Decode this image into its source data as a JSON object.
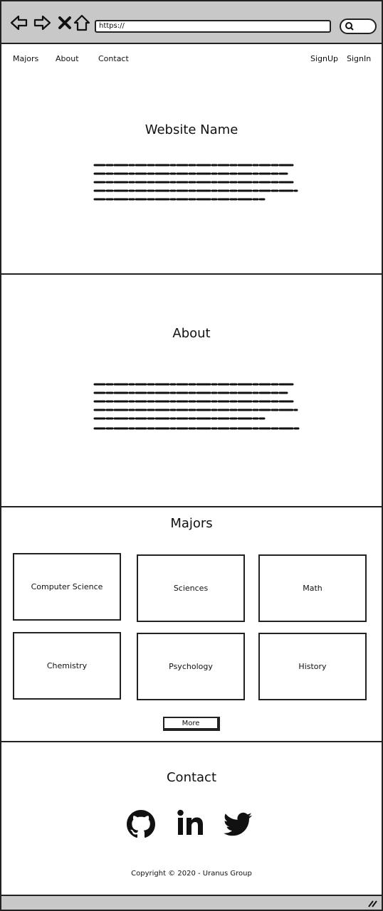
{
  "browser": {
    "url": "https://"
  },
  "nav": {
    "majors": "Majors",
    "about": "About",
    "contact": "Contact",
    "signup": "SignUp",
    "signin": "SignIn"
  },
  "hero": {
    "title": "Website Name"
  },
  "about": {
    "title": "About"
  },
  "majors": {
    "title": "Majors",
    "items": [
      {
        "label": "Computer Science"
      },
      {
        "label": "Sciences"
      },
      {
        "label": "Math"
      },
      {
        "label": "Chemistry"
      },
      {
        "label": "Psychology"
      },
      {
        "label": "History"
      }
    ],
    "more_label": "More"
  },
  "contact": {
    "title": "Contact",
    "social_icons": [
      "github-icon",
      "linkedin-icon",
      "twitter-icon"
    ],
    "copyright": "Copyright © 2020 - Uranus Group"
  }
}
